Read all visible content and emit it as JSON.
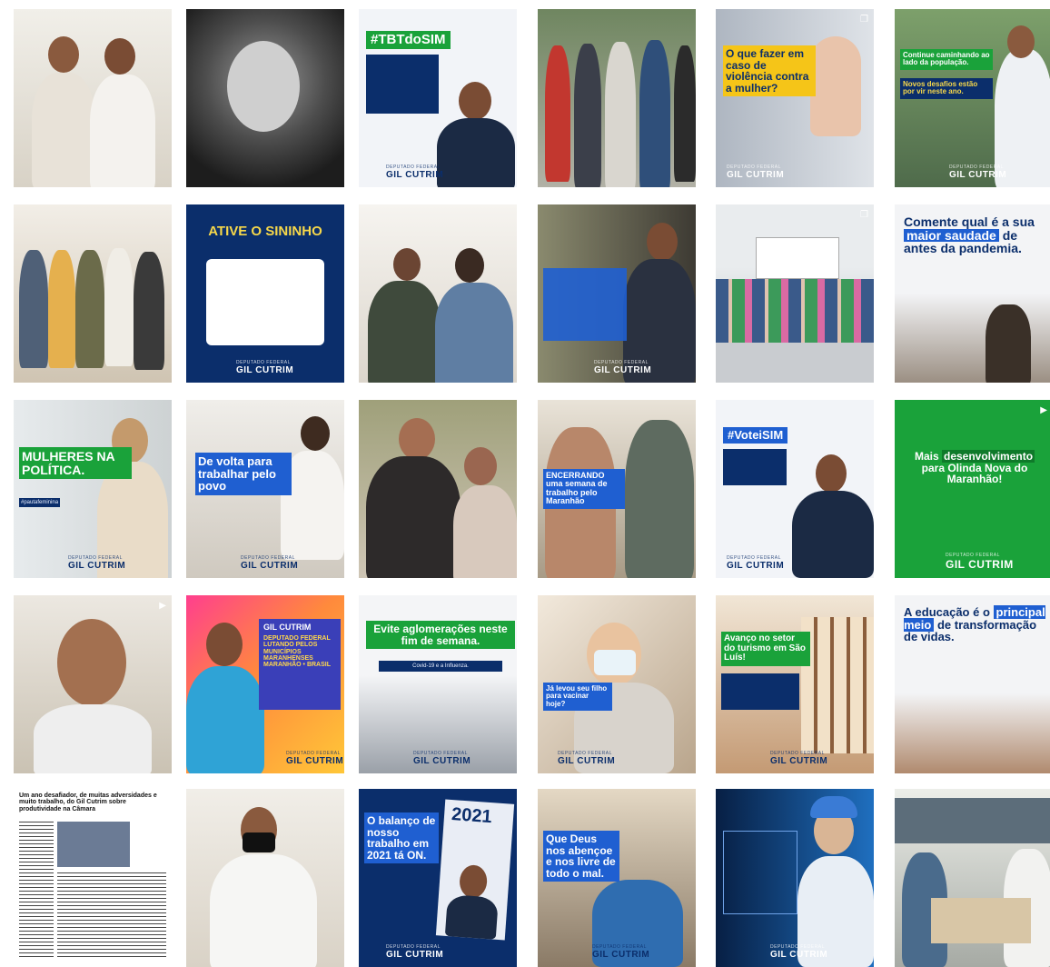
{
  "brand": "GIL CUTRIM",
  "brand_sub": "DEPUTADO FEDERAL",
  "left": {
    "tbt_title": "#TBTdoSIM",
    "sininho_title": "ATIVE O SININHO",
    "mulheres_title": "MULHERES NA POLÍTICA.",
    "mulheres_hashtag": "#pautafeminina",
    "devolta_title": "De volta para trabalhar pelo povo",
    "gil_poster_name": "GIL CUTRIM",
    "gil_poster_text": "DEPUTADO FEDERAL LUTANDO PELOS MUNICÍPIOS MARANHENSES MARANHÃO • BRASIL",
    "aglomeracoes_title": "Evite aglomerações neste fim de semana.",
    "aglomeracoes_sub": "Covid-19 e a Influenza.",
    "article_title": "Um ano desafiador, de muitas adversidades e muito trabalho, do Gil Cutrim sobre produtividade na Câmara",
    "balanco_title": "O balanço de nosso trabalho em 2021 tá ON.",
    "balanco_year": "2021"
  },
  "right": {
    "violencia_title": "O que fazer em caso de violência contra a mulher?",
    "continue_title": "Continue caminhando ao lado da população.",
    "continue_sub": "Novos desafios estão por vir neste ano.",
    "saudade_title_1": "Comente qual é a sua",
    "saudade_highlight": "maior saudade",
    "saudade_title_2": "de antes da pandemia.",
    "encerrando_title": "ENCERRANDO uma semana de trabalho pelo Maranhão",
    "votei_title": "#VoteiSIM",
    "mais_title_1": "Mais",
    "mais_highlight": "desenvolvimento",
    "mais_title_2": "para Olinda Nova do Maranhão!",
    "vacina_title": "Já levou seu filho para vacinar hoje?",
    "turismo_title": "Avanço no setor do turismo em São Luís!",
    "educacao_title_1": "A educação é o",
    "educacao_highlight": "principal meio",
    "educacao_title_2": "de transformação de vidas.",
    "deus_title": "Que Deus nos abençoe e nos livre de todo o mal."
  },
  "colors": {
    "navy": "#0b2e6b",
    "blue": "#1f5fd1",
    "green": "#1aa23a",
    "brand_green": "#1fb04a"
  }
}
